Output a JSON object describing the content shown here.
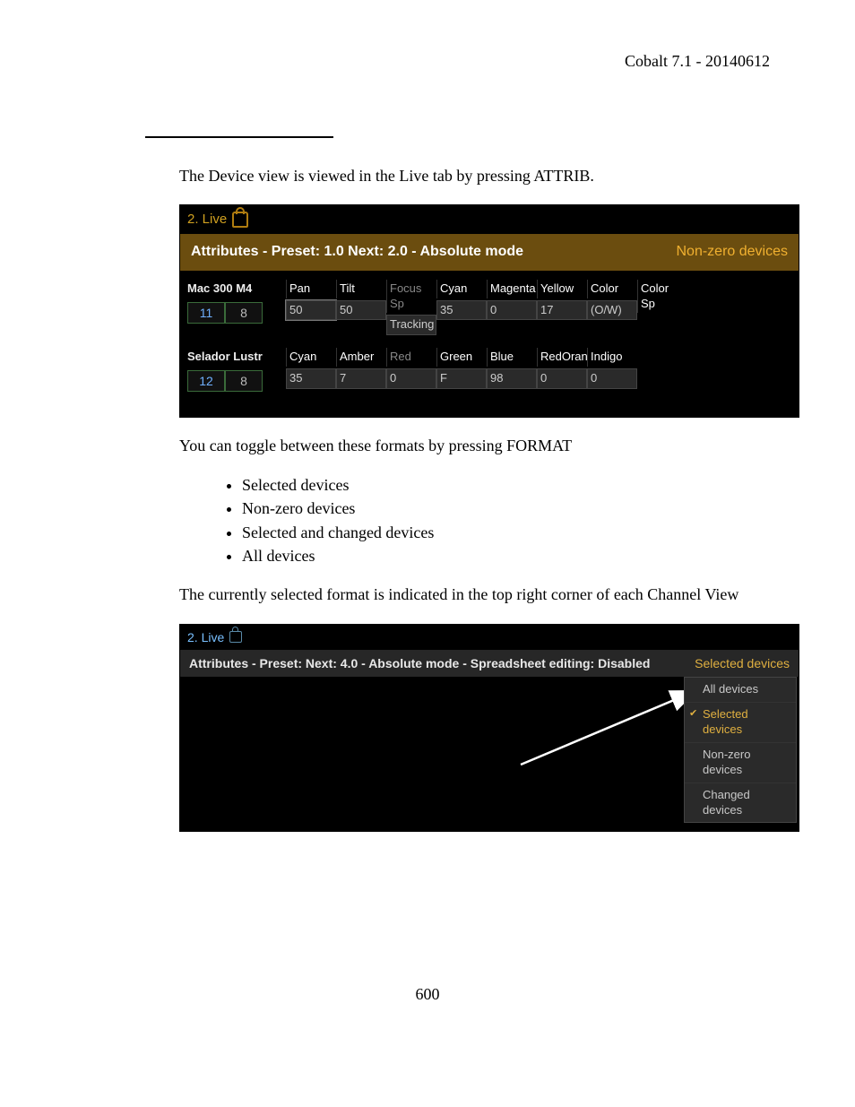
{
  "doc_header": "Cobalt 7.1 - 20140612",
  "page_number": "600",
  "para1": "The Device view is viewed in the Live tab by pressing ATTRIB.",
  "para2": "You can toggle between these formats by pressing FORMAT",
  "list": {
    "i0": "Selected devices",
    "i1": "Non-zero devices",
    "i2": "Selected and changed devices",
    "i3": "All devices"
  },
  "para3": "The currently selected format is indicated in the top right corner of each Channel View",
  "shot1": {
    "tab": "2. Live",
    "status_left": "Attributes - Preset: 1.0 Next: 2.0 - Absolute mode",
    "status_right": "Non-zero devices",
    "row1": {
      "name": "Mac 300 M4",
      "num1": "11",
      "num2": "8",
      "c": [
        {
          "h": "Pan",
          "v": "50"
        },
        {
          "h": "Tilt",
          "v": "50"
        },
        {
          "h": "Focus Sp",
          "v": "Tracking"
        },
        {
          "h": "Cyan",
          "v": "35"
        },
        {
          "h": "Magenta",
          "v": "0"
        },
        {
          "h": "Yellow",
          "v": "17"
        },
        {
          "h": "Color",
          "v": "(O/W)"
        },
        {
          "h": "Color Sp",
          "v": ""
        }
      ]
    },
    "row2": {
      "name": "Selador Lustr",
      "num1": "12",
      "num2": "8",
      "c": [
        {
          "h": "Cyan",
          "v": "35"
        },
        {
          "h": "Amber",
          "v": "7"
        },
        {
          "h": "Red",
          "v": "0"
        },
        {
          "h": "Green",
          "v": "F"
        },
        {
          "h": "Blue",
          "v": "98"
        },
        {
          "h": "RedOran",
          "v": "0"
        },
        {
          "h": "Indigo",
          "v": "0"
        }
      ]
    }
  },
  "shot2": {
    "tab": "2. Live",
    "status_left": "Attributes - Preset:  Next: 4.0 - Absolute mode - Spreadsheet editing: Disabled",
    "status_right": "Selected devices",
    "menu": {
      "i0": "All devices",
      "i1": "Selected devices",
      "i2": "Non-zero devices",
      "i3": "Changed devices"
    }
  }
}
